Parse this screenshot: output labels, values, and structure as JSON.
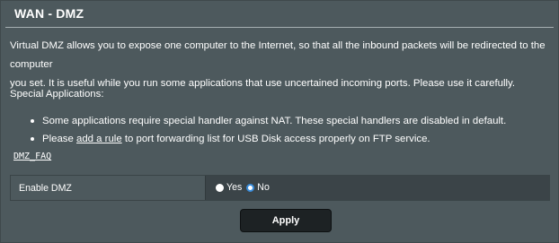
{
  "header": {
    "title": "WAN - DMZ"
  },
  "description": {
    "line1": "Virtual DMZ allows you to expose one computer to the Internet, so that all the inbound packets will be redirected to the computer",
    "line2": "you set. It is useful while you run some applications that use uncertained incoming ports. Please use it carefully."
  },
  "special_applications": {
    "heading": "Special Applications:",
    "bullet1": "Some applications require special handler against NAT. These special handlers are disabled in default.",
    "bullet2_prefix": "Please ",
    "bullet2_link": "add a rule",
    "bullet2_suffix": " to port forwarding list for USB Disk access properly on FTP service."
  },
  "faq_link": "DMZ_FAQ",
  "settings": {
    "enable_dmz_label": "Enable DMZ",
    "options": {
      "yes": "Yes",
      "no": "No"
    },
    "selected": "No"
  },
  "actions": {
    "apply_label": "Apply"
  }
}
